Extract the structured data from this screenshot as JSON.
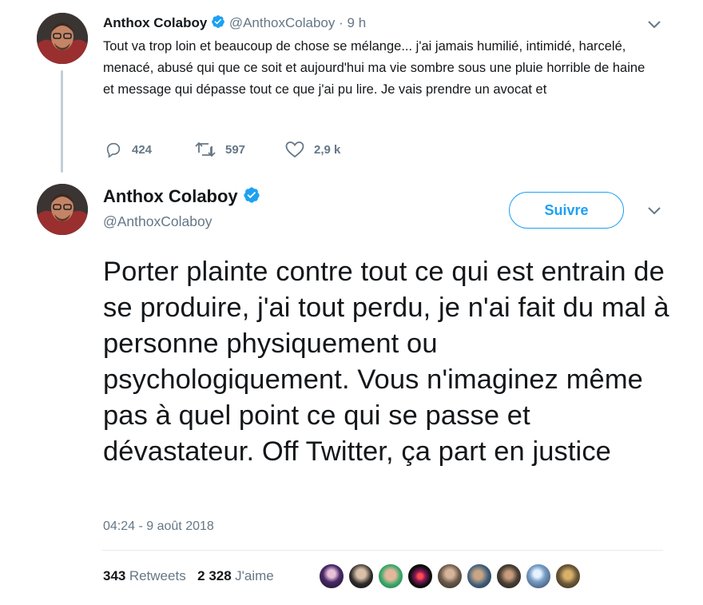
{
  "tweet_reply": {
    "author_name": "Anthox Colaboy",
    "author_handle": "@AnthoxColaboy",
    "time_sep": "·",
    "time": "9 h",
    "text": "Tout va trop loin et beaucoup de chose se mélange... j'ai jamais humilié, intimidé, harcelé, menacé, abusé qui que ce soit et aujourd'hui ma vie sombre sous une pluie horrible de haine et message qui dépasse tout ce que j'ai pu lire. Je vais prendre un avocat et",
    "reply_count": "424",
    "retweet_count": "597",
    "like_count": "2,9 k"
  },
  "tweet_main": {
    "author_name": "Anthox Colaboy",
    "author_handle": "@AnthoxColaboy",
    "follow_label": "Suivre",
    "text": "Porter plainte contre tout ce qui est entrain de se produire, j'ai tout perdu, je n'ai fait du mal à personne physiquement ou psychologiquement. Vous n'imaginez même pas à quel point ce qui se passe et dévastateur. Off Twitter, ça part en justice",
    "timestamp": "04:24 - 9 août 2018",
    "retweets_num": "343",
    "retweets_label": "Retweets",
    "likes_num": "2 328",
    "likes_label": "J'aime"
  },
  "colors": {
    "accent": "#1da1f2",
    "verified": "#1da1f2",
    "muted": "#657786",
    "text": "#14171a",
    "divider": "#e6ecf0"
  },
  "icons": [
    "verified-badge-icon",
    "chevron-down-icon",
    "reply-icon",
    "retweet-icon",
    "like-icon"
  ]
}
